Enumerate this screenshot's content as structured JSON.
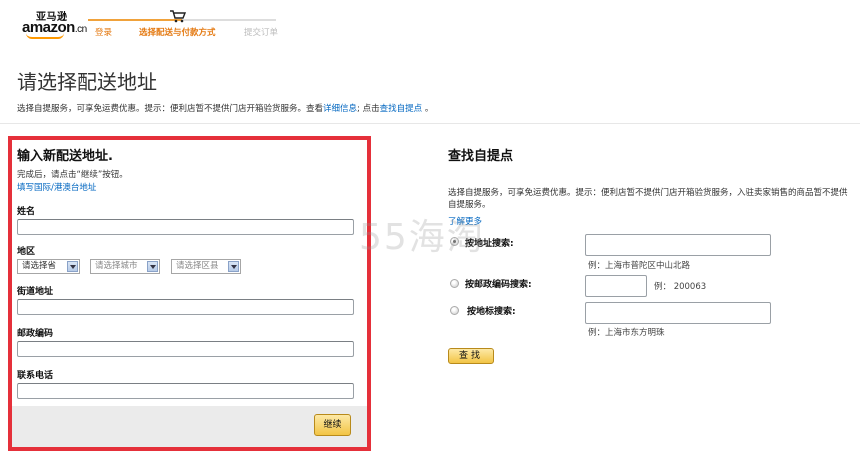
{
  "header": {
    "logo_cn": "亚马逊",
    "logo_main": "amazon",
    "logo_suffix": ".cn",
    "steps": [
      "登录",
      "选择配送与付款方式",
      "提交订单"
    ],
    "cart_icon": "cart-icon"
  },
  "page": {
    "title": "请选择配送地址",
    "intro_text": "选择自提服务，可享免运费优惠。提示：便利店暂不提供门店开箱验货服务。查看",
    "intro_link1": "详细信息",
    "intro_mid": "; 点击",
    "intro_link2": "查找自提点",
    "intro_end": " 。"
  },
  "form": {
    "title": "输入新配送地址.",
    "subtitle": "完成后，请点击“继续”按钮。",
    "intl_link": "填写国际/港澳台地址",
    "name_label": "姓名",
    "region_label": "地区",
    "province_select": "请选择省",
    "city_select": "请选择城市",
    "district_select": "请选择区县",
    "street_label": "街道地址",
    "postcode_label": "邮政编码",
    "phone_label": "联系电话",
    "continue_button": "继续"
  },
  "pickup": {
    "title": "查找自提点",
    "desc": "选择自提服务，可享免运费优惠。提示：便利店暂不提供门店开箱验货服务，入驻卖家销售的商品暂不提供自提服务。",
    "learn_more": "了解更多",
    "options": [
      {
        "label": "按地址搜索:",
        "example": "例：上海市普陀区中山北路",
        "selected": true
      },
      {
        "label": "按邮政编码搜索:",
        "example": "例： 200063",
        "selected": false
      },
      {
        "label": "按地标搜索:",
        "example": "例：上海市东方明珠",
        "selected": false
      }
    ],
    "find_button": "查找"
  },
  "watermark": "55海淘",
  "colors": {
    "accent_orange": "#e47911",
    "link_blue": "#0066c0",
    "highlight_red": "#e5303a",
    "button_gold": "#f2c445"
  }
}
